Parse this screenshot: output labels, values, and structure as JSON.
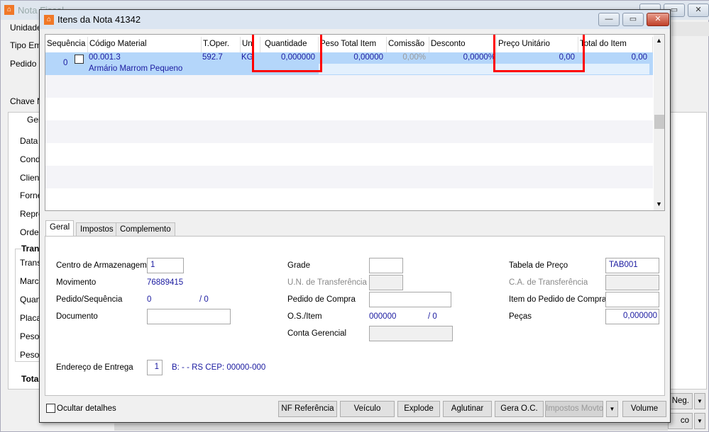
{
  "background_window": {
    "title": "Nota Fiscal",
    "labels": [
      "Unidade",
      "Tipo Emis",
      "Pedido",
      "Chave N"
    ],
    "tab": "Geral",
    "form_labels": [
      "Data",
      "Condi",
      "Client",
      "Forne",
      "Repre",
      "Order"
    ],
    "group_title": "Tran",
    "group_labels": [
      "Trans",
      "Marca",
      "Quan",
      "Placa",
      "Peso",
      "Peso"
    ],
    "total_label": "Tota",
    "buttons": [
      "Neg.",
      "co"
    ]
  },
  "dialog": {
    "title": "Itens da Nota 41342"
  },
  "grid": {
    "columns": [
      "Sequência",
      "Código Material",
      "T.Oper.",
      "Un",
      "Quantidade",
      "Peso Total Item",
      "Comissão",
      "Desconto",
      "Preço Unitário",
      "Total do Item"
    ],
    "rows": [
      {
        "sequencia": "0",
        "codigo": "00.001.3",
        "descricao": "Armário Marrom Pequeno",
        "t_oper": "592.7",
        "un": "KG",
        "quantidade": "0,000000",
        "peso_total": "0,00000",
        "comissao": "0,00%",
        "desconto": "0,0000%",
        "preco_unitario": "0,00",
        "total_item": "0,00"
      }
    ]
  },
  "tabs": [
    "Geral",
    "Impostos",
    "Complemento"
  ],
  "form": {
    "centro_armazenagem": {
      "label": "Centro de Armazenagem",
      "value": "1"
    },
    "movimento": {
      "label": "Movimento",
      "value": "76889415"
    },
    "pedido_sequencia": {
      "label": "Pedido/Sequência",
      "value": "0",
      "sep": "/ 0"
    },
    "documento": {
      "label": "Documento",
      "value": ""
    },
    "endereco_entrega": {
      "label": "Endereço de Entrega",
      "value": "1",
      "text": "B:  -  - RS CEP: 00000-000"
    },
    "grade": {
      "label": "Grade",
      "value": ""
    },
    "un_transferencia": {
      "label": "U.N. de Transferência",
      "value": ""
    },
    "pedido_compra": {
      "label": "Pedido de Compra",
      "value": ""
    },
    "os_item": {
      "label": "O.S./Item",
      "value": "000000",
      "sep": "/ 0"
    },
    "conta_gerencial": {
      "label": "Conta Gerencial",
      "value": ""
    },
    "tabela_preco": {
      "label": "Tabela de Preço",
      "value": "TAB001"
    },
    "ca_transferencia": {
      "label": "C.A. de Transferência",
      "value": ""
    },
    "item_pedido_compra": {
      "label": "Item do Pedido de Compra",
      "value": ""
    },
    "pecas": {
      "label": "Peças",
      "value": "0,000000"
    }
  },
  "footer": {
    "ocultar": "Ocultar detalhes",
    "buttons": [
      "NF Referência",
      "Veículo",
      "Explode",
      "Aglutinar",
      "Gera O.C.",
      "Impostos Movto",
      "Volume"
    ]
  }
}
